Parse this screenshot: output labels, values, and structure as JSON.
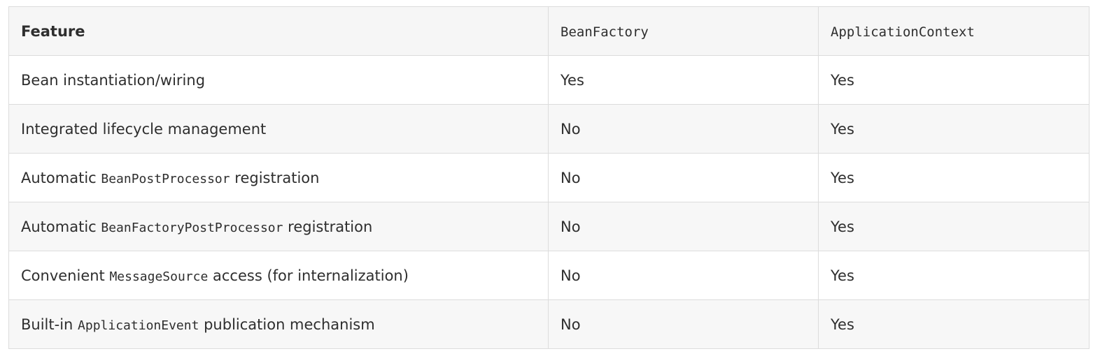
{
  "table": {
    "headers": [
      "Feature",
      "BeanFactory",
      "ApplicationContext"
    ],
    "rows": [
      {
        "feature_prefix": "Bean instantiation/wiring",
        "feature_code": "",
        "feature_suffix": "",
        "bean_factory": "Yes",
        "application_context": "Yes"
      },
      {
        "feature_prefix": "Integrated lifecycle management",
        "feature_code": "",
        "feature_suffix": "",
        "bean_factory": "No",
        "application_context": "Yes"
      },
      {
        "feature_prefix": "Automatic ",
        "feature_code": "BeanPostProcessor",
        "feature_suffix": " registration",
        "bean_factory": "No",
        "application_context": "Yes"
      },
      {
        "feature_prefix": "Automatic ",
        "feature_code": "BeanFactoryPostProcessor",
        "feature_suffix": " registration",
        "bean_factory": "No",
        "application_context": "Yes"
      },
      {
        "feature_prefix": "Convenient ",
        "feature_code": "MessageSource",
        "feature_suffix": " access (for internalization)",
        "bean_factory": "No",
        "application_context": "Yes"
      },
      {
        "feature_prefix": "Built-in ",
        "feature_code": "ApplicationEvent",
        "feature_suffix": " publication mechanism",
        "bean_factory": "No",
        "application_context": "Yes"
      }
    ]
  }
}
